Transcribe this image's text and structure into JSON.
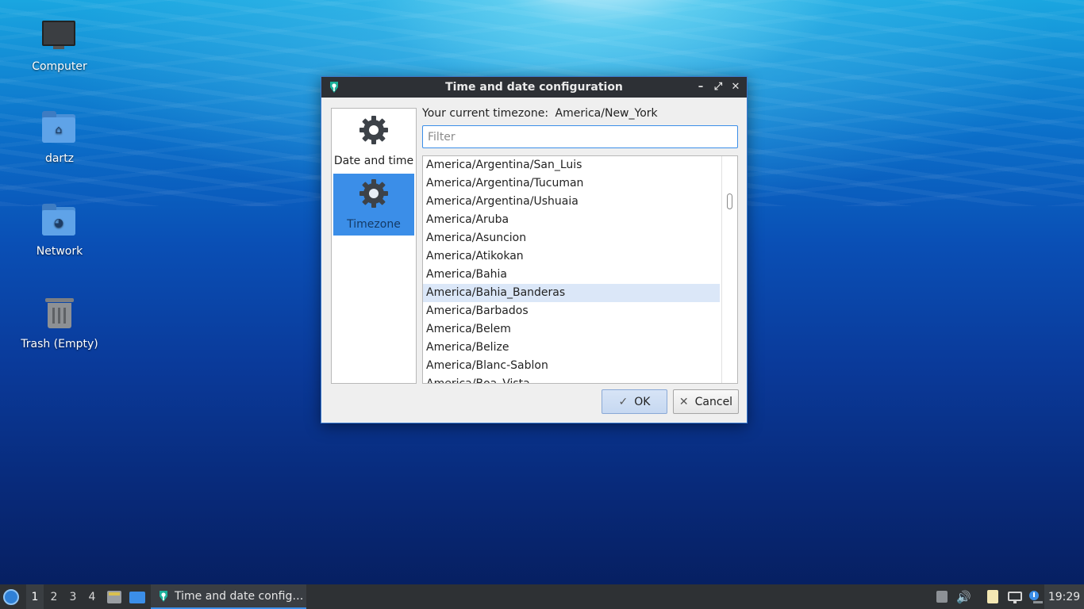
{
  "desktop": {
    "icons": [
      {
        "label": "Computer",
        "icon": "computer-icon"
      },
      {
        "label": "dartz",
        "icon": "home-folder-icon"
      },
      {
        "label": "Network",
        "icon": "network-folder-icon"
      },
      {
        "label": "Trash (Empty)",
        "icon": "trash-icon"
      }
    ]
  },
  "dialog": {
    "title": "Time and date configuration",
    "window_buttons": [
      "minimize",
      "maximize",
      "close"
    ],
    "sidebar": [
      {
        "label": "Date and time",
        "icon": "gear-icon",
        "active": false
      },
      {
        "label": "Timezone",
        "icon": "gear-icon",
        "active": true
      }
    ],
    "current_timezone_label": "Your current timezone:",
    "current_timezone_value": "America/New_York",
    "filter_placeholder": "Filter",
    "timezones": [
      "America/Argentina/San_Luis",
      "America/Argentina/Tucuman",
      "America/Argentina/Ushuaia",
      "America/Aruba",
      "America/Asuncion",
      "America/Atikokan",
      "America/Bahia",
      "America/Bahia_Banderas",
      "America/Barbados",
      "America/Belem",
      "America/Belize",
      "America/Blanc-Sablon",
      "America/Boa_Vista"
    ],
    "selected_timezone": "America/Bahia_Banderas",
    "ok_label": "OK",
    "cancel_label": "Cancel"
  },
  "taskbar": {
    "workspaces": [
      "1",
      "2",
      "3",
      "4"
    ],
    "active_workspace": "1",
    "task_label": "Time and date config…",
    "clock": "19:29",
    "accent": "#3b8ee8"
  }
}
